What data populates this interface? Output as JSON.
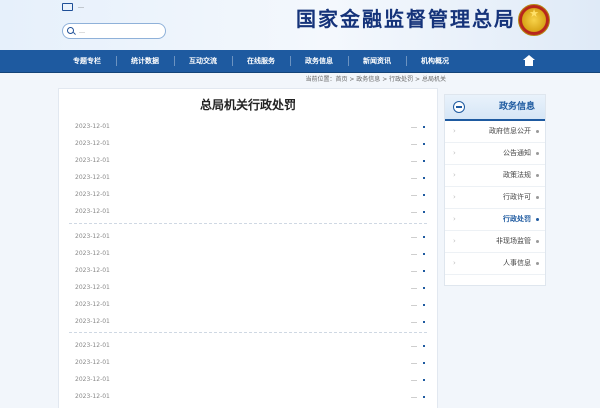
{
  "header": {
    "site_title": "国家金融监督管理总局",
    "top_links": "…",
    "search_placeholder": "…"
  },
  "nav": {
    "items": [
      {
        "label": "机构概况"
      },
      {
        "label": "新闻资讯"
      },
      {
        "label": "政务信息"
      },
      {
        "label": "在线服务"
      },
      {
        "label": "互动交流"
      },
      {
        "label": "统计数据"
      },
      {
        "label": "专题专栏"
      }
    ]
  },
  "breadcrumb": "当前位置：首页 > 政务信息 > 行政处罚 > 总局机关",
  "content": {
    "title": "总局机关行政处罚",
    "items": [
      {
        "title": "…",
        "date": "2023-12-01"
      },
      {
        "title": "…",
        "date": "2023-12-01"
      },
      {
        "title": "…",
        "date": "2023-12-01"
      },
      {
        "title": "…",
        "date": "2023-12-01"
      },
      {
        "title": "…",
        "date": "2023-12-01"
      },
      {
        "title": "…",
        "date": "2023-12-01"
      },
      {
        "title": "…",
        "date": "2023-12-01"
      },
      {
        "title": "…",
        "date": "2023-12-01"
      },
      {
        "title": "…",
        "date": "2023-12-01"
      },
      {
        "title": "…",
        "date": "2023-12-01"
      },
      {
        "title": "…",
        "date": "2023-12-01"
      },
      {
        "title": "…",
        "date": "2023-12-01"
      },
      {
        "title": "…",
        "date": "2023-12-01"
      },
      {
        "title": "…",
        "date": "2023-12-01"
      },
      {
        "title": "…",
        "date": "2023-12-01"
      },
      {
        "title": "…",
        "date": "2023-12-01"
      }
    ]
  },
  "sidebar": {
    "heading": "政务信息",
    "items": [
      {
        "label": "政府信息公开"
      },
      {
        "label": "公告通知"
      },
      {
        "label": "政策法规"
      },
      {
        "label": "行政许可"
      },
      {
        "label": "行政处罚"
      },
      {
        "label": "非现场监管"
      },
      {
        "label": "人事信息"
      }
    ]
  }
}
